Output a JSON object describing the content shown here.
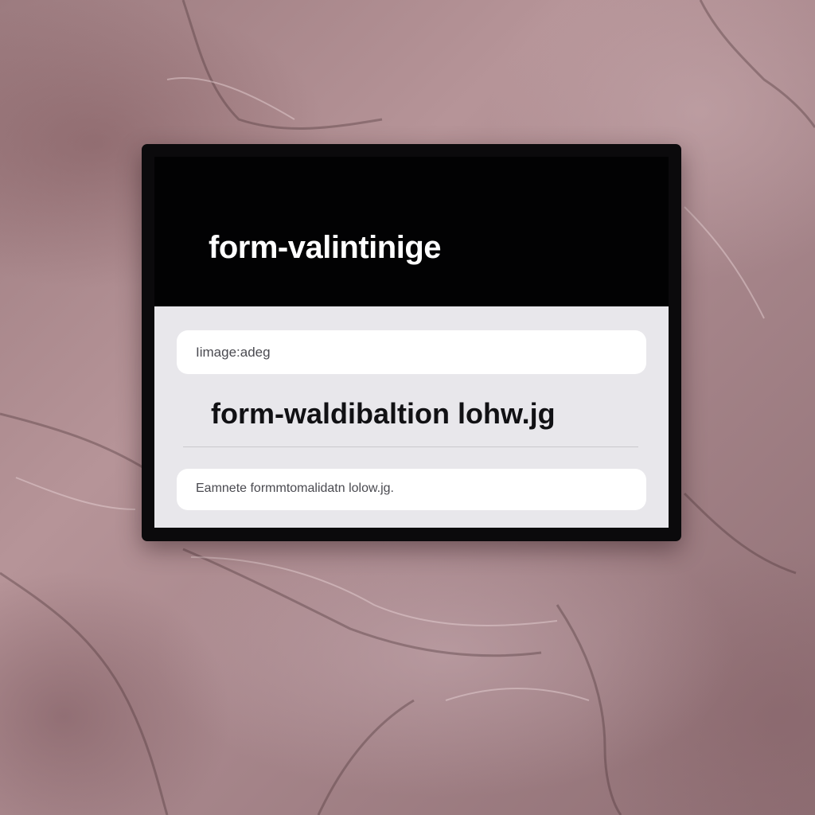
{
  "window": {
    "title": "form-valintinige"
  },
  "form": {
    "top_field_value": "Iimage:adeg",
    "main_text": "form-waldibaltion lohw.jg",
    "bottom_field_value": "Eamnete formmtomalidatn lolow.jg."
  },
  "colors": {
    "header_background": "#020203",
    "panel_background": "#e8e7eb",
    "field_background": "#ffffff",
    "background_texture": "#a6858a"
  }
}
